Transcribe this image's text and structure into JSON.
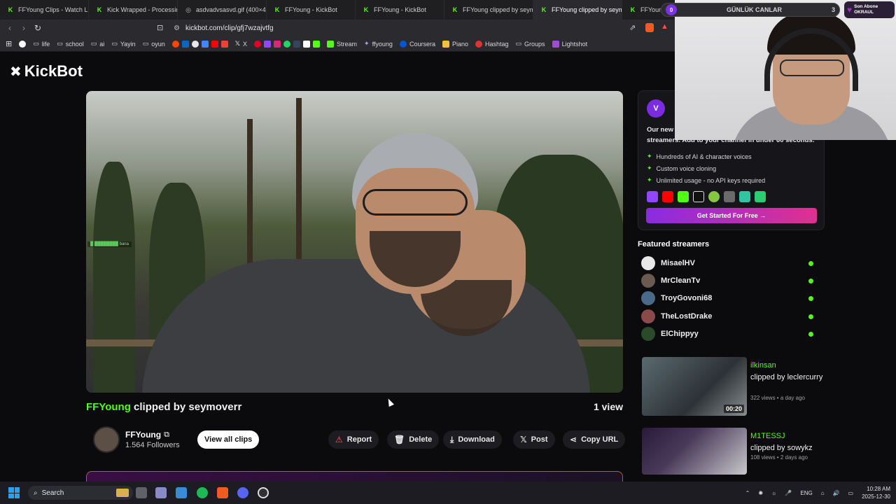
{
  "browser": {
    "tabs": [
      {
        "title": "FFYoung Clips - Watch Liv",
        "icon": "kick-icon"
      },
      {
        "title": "Kick Wrapped - Processing",
        "icon": "kick-icon"
      },
      {
        "title": "asdvadvsasvd.gif (400×40",
        "icon": "globe-icon"
      },
      {
        "title": "FFYoung - KickBot",
        "icon": "kick-icon"
      },
      {
        "title": "FFYoung - KickBot",
        "icon": "kick-icon"
      },
      {
        "title": "FFYoung clipped by seym",
        "icon": "kick-icon"
      },
      {
        "title": "FFYoung clipped by seym",
        "icon": "kick-icon"
      },
      {
        "title": "FFYoung",
        "icon": "kick-icon"
      }
    ],
    "url": "kickbot.com/clip/gfj7wzajvtfg",
    "bookmarks": [
      "life",
      "school",
      "ai",
      "Yayin",
      "oyun",
      "X",
      "Stream",
      "ffyoung",
      "Coursera",
      "Piano",
      "Hashtag",
      "Groups",
      "Lightshot"
    ]
  },
  "page": {
    "brand": "KickBot",
    "video_chat_line": "bana",
    "clip": {
      "streamer": "FFYoung",
      "title_suffix": " clipped by seymoverr",
      "views": "1 view"
    },
    "channel": {
      "name": "FFYoung",
      "followers": "1.564 Followers",
      "view_all": "View all clips"
    },
    "actions": {
      "report": "Report",
      "delete": "Delete",
      "download": "Download",
      "post": "Post",
      "copy_url": "Copy URL"
    }
  },
  "sidebar": {
    "promo": {
      "intro_start": "Our new",
      "intro_end": "streamers. Add to your channel in under 60 seconds.",
      "features": [
        "Hundreds of AI & character voices",
        "Custom voice cloning",
        "Unlimited usage - no API keys required"
      ],
      "cta": "Get Started For Free →",
      "accent": "#8a2be2"
    },
    "featured_title": "Featured streamers",
    "featured": [
      "MisaelHV",
      "MrCleanTv",
      "TroyGovoni68",
      "TheLostDrake",
      "ElChippyy"
    ],
    "clips": [
      {
        "name": "ilkinsan",
        "by": "clipped by leclercurry",
        "meta": "322 views • a day ago",
        "duration": "00:20"
      },
      {
        "name": "M1TESSJ",
        "by": "clipped by sowykz",
        "meta": "108 views • 2 days ago",
        "duration": ""
      }
    ]
  },
  "overlay": {
    "counter_label": "GÜNLÜK CANLAR",
    "counter_left": "0",
    "counter_right": "3",
    "sub_line1": "Son Abone",
    "sub_line2": "OKRAUL"
  },
  "taskbar": {
    "search": "Search",
    "lang": "ENG",
    "time": "10:28 AM",
    "date": "2025-12-30"
  },
  "colors": {
    "kick_green": "#53fc18",
    "background": "#0b0b0d"
  }
}
